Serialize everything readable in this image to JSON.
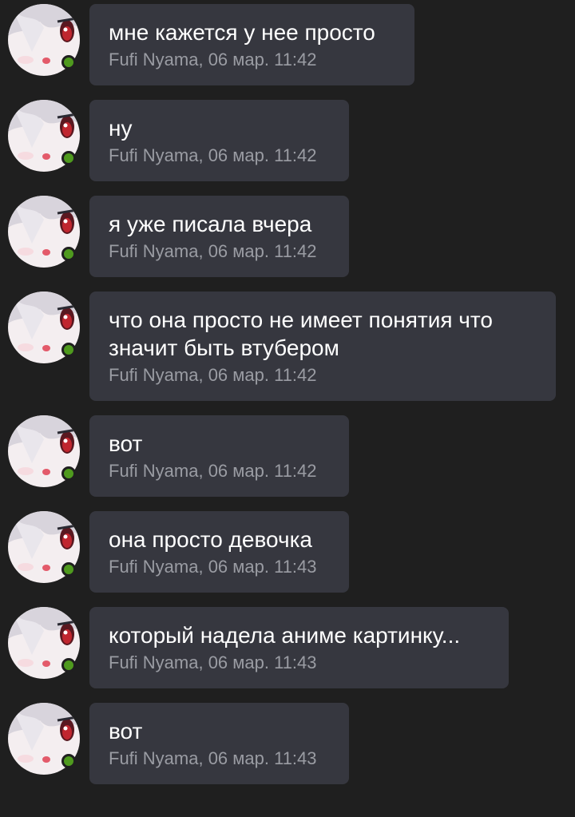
{
  "messages": [
    {
      "text": "мне кажется у нее просто",
      "meta": "Fufi Nyama, 06 мар. 11:42"
    },
    {
      "text": "ну",
      "meta": "Fufi Nyama, 06 мар. 11:42"
    },
    {
      "text": "я уже писала вчера",
      "meta": "Fufi Nyama, 06 мар. 11:42"
    },
    {
      "text": "что она просто не имеет понятия что\nзначит быть втубером",
      "meta": "Fufi Nyama, 06 мар. 11:42"
    },
    {
      "text": "вот",
      "meta": "Fufi Nyama, 06 мар. 11:42"
    },
    {
      "text": "она просто девочка",
      "meta": "Fufi Nyama, 06 мар. 11:43"
    },
    {
      "text": "который надела аниме картинку...",
      "meta": "Fufi Nyama, 06 мар. 11:43"
    },
    {
      "text": "вот",
      "meta": "Fufi Nyama, 06 мар. 11:43"
    }
  ],
  "colors": {
    "background": "#1f1f1f",
    "bubble": "#36373f",
    "text": "#ffffff",
    "meta": "#9a9ca3",
    "online": "#4f9a1e"
  },
  "icons": {
    "avatar": "anime-girl-avatar",
    "status": "online-status-dot"
  }
}
